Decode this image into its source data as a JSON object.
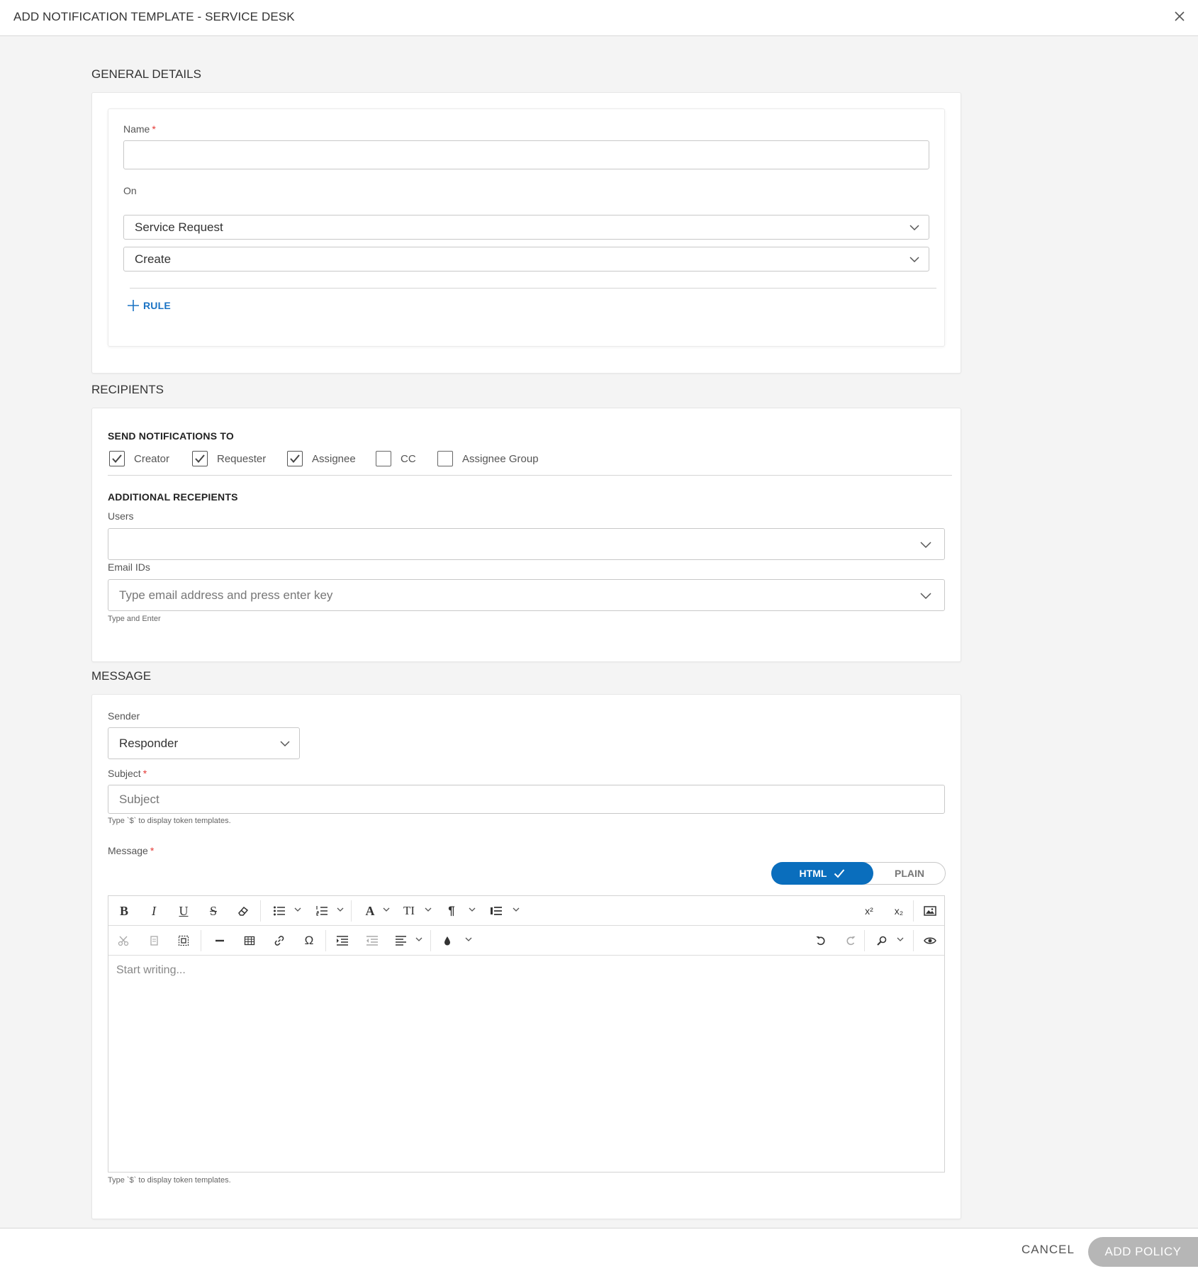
{
  "header": {
    "title": "ADD NOTIFICATION TEMPLATE - SERVICE DESK"
  },
  "general": {
    "section_title": "GENERAL DETAILS",
    "name_label": "Name",
    "required_mark": "*",
    "name_value": "",
    "on_label": "On",
    "on_entity": "Service Request",
    "on_event": "Create",
    "rule_button": "RULE"
  },
  "recipients": {
    "section_title": "RECIPIENTS",
    "send_to_label": "SEND NOTIFICATIONS TO",
    "options": [
      {
        "label": "Creator",
        "checked": true
      },
      {
        "label": "Requester",
        "checked": true
      },
      {
        "label": "Assignee",
        "checked": true
      },
      {
        "label": "CC",
        "checked": false
      },
      {
        "label": "Assignee Group",
        "checked": false
      }
    ],
    "additional_label": "ADDITIONAL RECEPIENTS",
    "users_label": "Users",
    "users_value": "",
    "email_label": "Email IDs",
    "email_placeholder": "Type email address and press enter key",
    "email_hint": "Type and Enter"
  },
  "message": {
    "section_title": "MESSAGE",
    "sender_label": "Sender",
    "sender_value": "Responder",
    "subject_label": "Subject",
    "subject_placeholder": "Subject",
    "subject_hint": "Type `$` to display token templates.",
    "message_label": "Message",
    "toggle_html": "HTML",
    "toggle_plain": "PLAIN",
    "toggle_selected": "HTML",
    "editor_placeholder": "Start writing...",
    "message_hint": "Type `$` to display token templates.",
    "toolbar_text": {
      "superscript": "x²",
      "subscript": "x₂"
    }
  },
  "footer": {
    "cancel": "CANCEL",
    "add": "ADD POLICY"
  },
  "colors": {
    "accent": "#0a6ebd",
    "link": "#1a73c4",
    "required": "#e53935",
    "disabled_button": "#b6b6b6"
  }
}
